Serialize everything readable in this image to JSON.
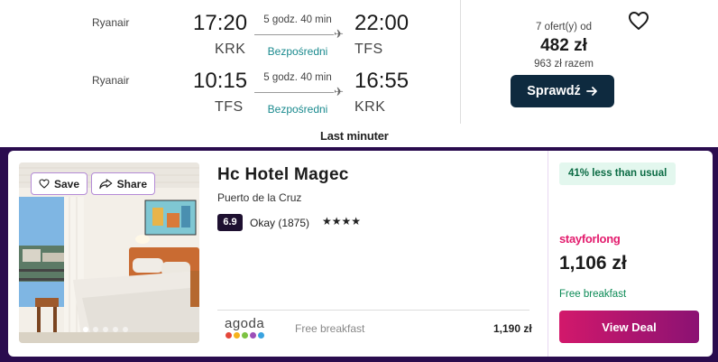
{
  "flight": {
    "legs": [
      {
        "airline": "Ryanair",
        "dep_time": "17:20",
        "arr_time": "22:00",
        "dep_code": "KRK",
        "arr_code": "TFS",
        "duration": "5 godz. 40 min",
        "stops": "Bezpośredni"
      },
      {
        "airline": "Ryanair",
        "dep_time": "10:15",
        "arr_time": "16:55",
        "dep_code": "TFS",
        "arr_code": "KRK",
        "duration": "5 godz. 40 min",
        "stops": "Bezpośredni"
      }
    ],
    "offers": "7 ofert(y) od",
    "price": "482 zł",
    "total": "963 zł razem",
    "check_label": "Sprawdź",
    "provider_logo": "Last minuter",
    "icons": {
      "save": "heart-icon",
      "plane": "plane-icon",
      "arrow": "arrow-right-icon"
    }
  },
  "hotel": {
    "save_label": "Save",
    "share_label": "Share",
    "name": "Hc Hotel Magec",
    "location": "Puerto de la Cruz",
    "rating": "6.9",
    "rating_text": "Okay (1875)",
    "stars": "★★★★",
    "stars_count": 4,
    "photo_index": 1,
    "photo_count": 5,
    "deals": [
      {
        "provider": "agoda",
        "note": "Free breakfast",
        "price": "1,190 zł"
      }
    ],
    "badge": "41% less than usual",
    "best_provider": "stayforlong",
    "best_price": "1,106 zł",
    "best_note": "Free breakfast",
    "view_deal_label": "View Deal",
    "colors": {
      "accent": "#e31b6d",
      "header_bg": "#2a0c4e",
      "button_dark": "#0e2a3f",
      "stops": "#1a8a8e",
      "badge_bg": "#e3f7ee"
    }
  }
}
